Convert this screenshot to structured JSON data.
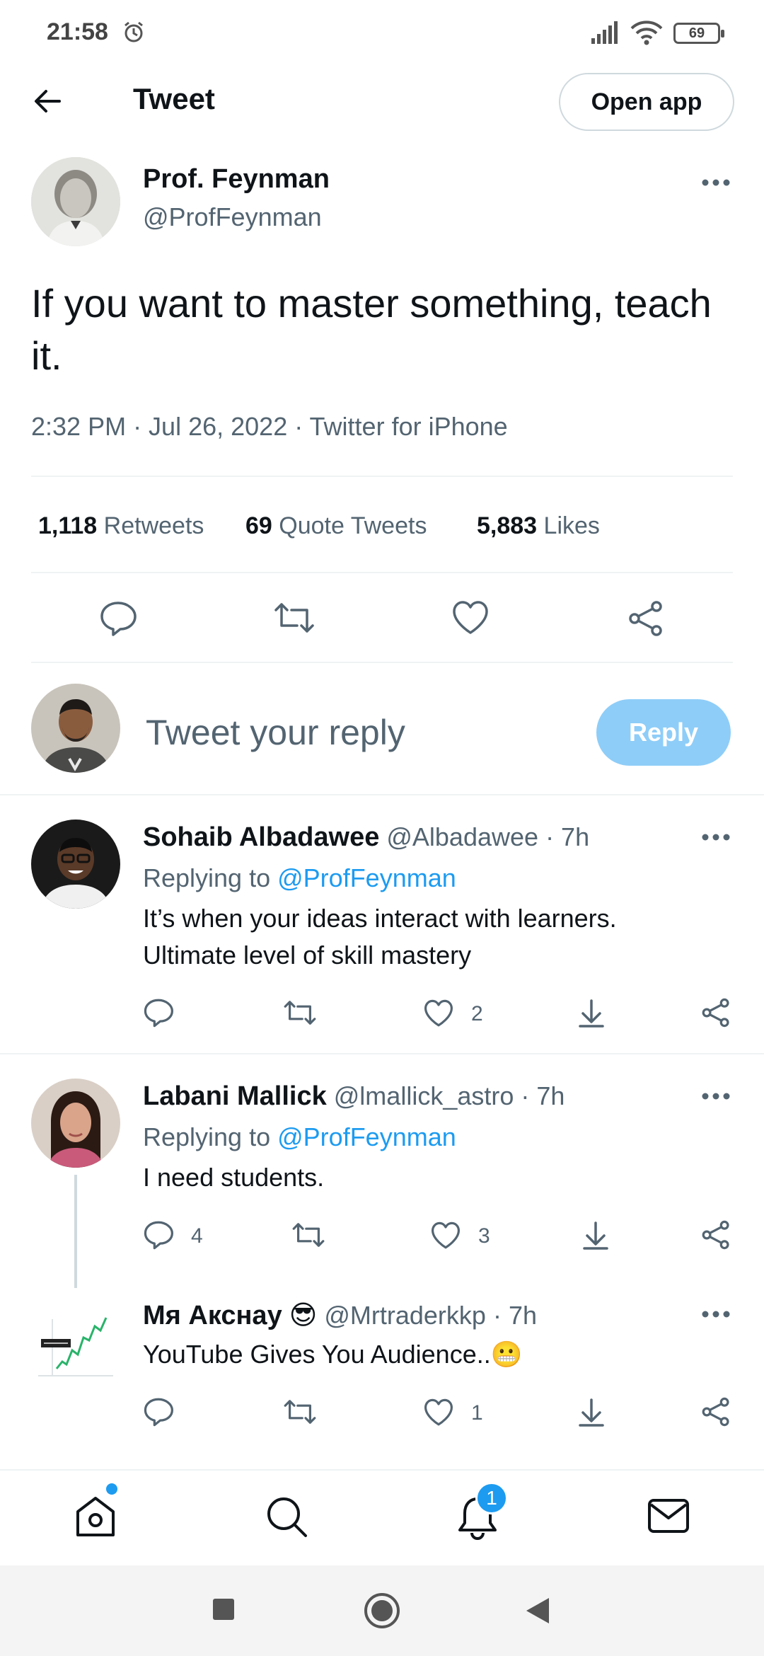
{
  "status_bar": {
    "time": "21:58",
    "battery": "69"
  },
  "header": {
    "title": "Tweet",
    "open_app_label": "Open app"
  },
  "tweet": {
    "author_name": "Prof. Feynman",
    "author_handle": "@ProfFeynman",
    "text": "If you want to master something, teach it.",
    "meta": "2:32 PM · Jul 26, 2022 · Twitter for iPhone",
    "stats": {
      "retweets_count": "1,118",
      "retweets_label": "Retweets",
      "quotes_count": "69",
      "quotes_label": "Quote Tweets",
      "likes_count": "5,883",
      "likes_label": "Likes"
    }
  },
  "composer": {
    "placeholder": "Tweet your reply",
    "reply_label": "Reply"
  },
  "replies": [
    {
      "name": "Sohaib Albadawee",
      "handle": "@Albadawee",
      "time": "· 7h",
      "replying_to_label": "Replying to",
      "replying_to": "@ProfFeynman",
      "text_lines": [
        "It’s when your ideas interact with learners.",
        "Ultimate level of skill mastery"
      ],
      "like_count": "2"
    },
    {
      "name": "Labani Mallick",
      "handle": "@lmallick_astro",
      "time": "· 7h",
      "replying_to_label": "Replying to",
      "replying_to": "@ProfFeynman",
      "text": "I need students.",
      "reply_count": "4",
      "like_count": "3"
    },
    {
      "name": "Мя Акснау",
      "name_emoji": "😎",
      "handle": "@Mrtraderkkp",
      "time": "· 7h",
      "text": "YouTube Gives You Audience..",
      "text_emoji": "😬",
      "like_count": "1"
    }
  ],
  "bottom_nav": {
    "notification_count": "1"
  },
  "colors": {
    "accent": "#1d9bf0",
    "reply_button": "#8ecdf8",
    "secondary_text": "#536471",
    "divider": "#eff3f4"
  }
}
